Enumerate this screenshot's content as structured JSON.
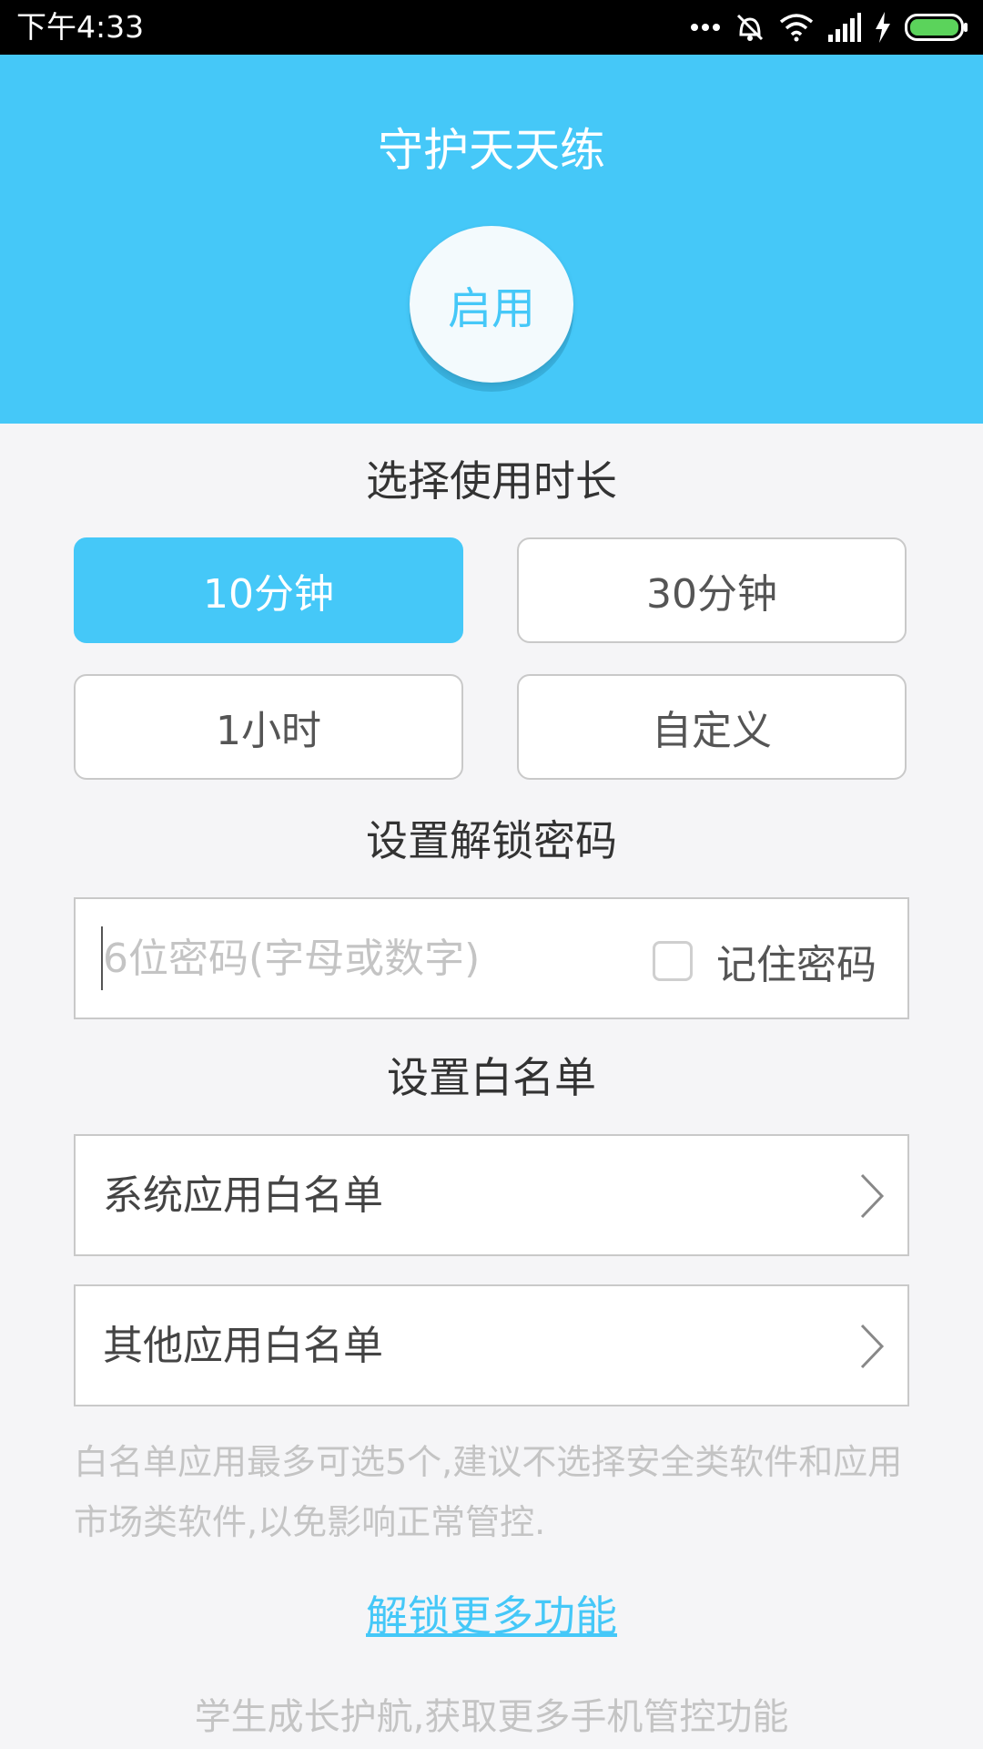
{
  "status_bar": {
    "time": "下午4:33",
    "icons": [
      "more-dots-icon",
      "mute-vibrate-icon",
      "wifi-icon",
      "signal-icon",
      "charging-icon",
      "battery-icon"
    ]
  },
  "header": {
    "title": "守护天天练",
    "enable_button": "启用"
  },
  "duration": {
    "title": "选择使用时长",
    "options": [
      {
        "label": "10分钟",
        "selected": true
      },
      {
        "label": "30分钟",
        "selected": false
      },
      {
        "label": "1小时",
        "selected": false
      },
      {
        "label": "自定义",
        "selected": false
      }
    ]
  },
  "password": {
    "title": "设置解锁密码",
    "value": "",
    "placeholder": "6位密码(字母或数字)",
    "remember_label": "记住密码",
    "remember_checked": false
  },
  "whitelist": {
    "title": "设置白名单",
    "items": [
      {
        "label": "系统应用白名单"
      },
      {
        "label": "其他应用白名单"
      }
    ],
    "note": "白名单应用最多可选5个,建议不选择安全类软件和应用市场类软件,以免影响正常管控."
  },
  "unlock_more": "解锁更多功能",
  "footer": "学生成长护航,获取更多手机管控功能",
  "colors": {
    "accent": "#45c8f8",
    "background": "#f5f5f7",
    "border": "#c9c9c9",
    "muted_text": "#c4c4c4"
  }
}
